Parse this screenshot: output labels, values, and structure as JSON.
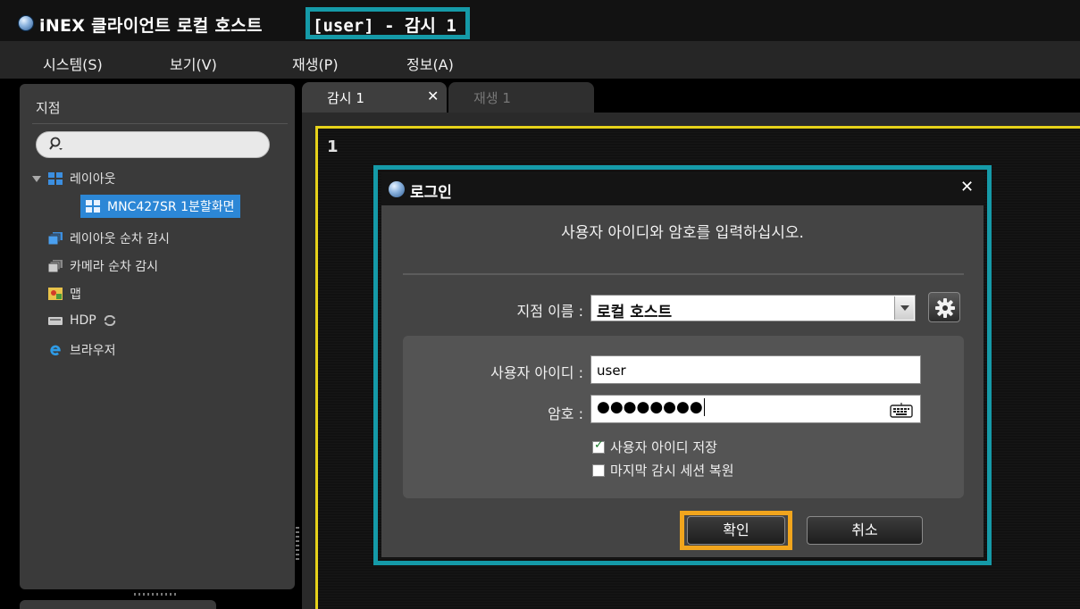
{
  "titlebar": {
    "title": "iNEX 클라이언트 로컬 호스트",
    "active_title": "[user] - 감시 1"
  },
  "menu": {
    "items": [
      "시스템(S)",
      "보기(V)",
      "재생(P)",
      "정보(A)"
    ]
  },
  "sidebar": {
    "title": "지점",
    "search_placeholder": "",
    "tree": {
      "layout": "레이아웃",
      "layout_child": "MNC427SR 1분할화면",
      "layout_sequence": "레이아웃 순차 감시",
      "camera_sequence": "카메라 순차 감시",
      "map": "맵",
      "hdp": "HDP",
      "browser": "브라우저"
    }
  },
  "tabs": [
    {
      "label": "감시 1",
      "active": true
    },
    {
      "label": "재생 1",
      "active": false
    }
  ],
  "view": {
    "number": "1"
  },
  "dialog": {
    "title": "로그인",
    "message": "사용자 아이디와 암호를 입력하십시오.",
    "site_label": "지점 이름 :",
    "site_value": "로컬 호스트",
    "user_label": "사용자 아이디 :",
    "user_value": "user",
    "password_label": "암호 :",
    "password_value": "●●●●●●●●",
    "save_id_label": "사용자 아이디 저장",
    "save_id_checked": true,
    "restore_label": "마지막 감시 세션 복원",
    "restore_checked": false,
    "ok_label": "확인",
    "cancel_label": "취소"
  },
  "colors": {
    "highlight_teal": "#159aa8",
    "highlight_orange": "#f1a51d",
    "view_border_yellow": "#e6d21a",
    "selection_blue": "#2c87d6"
  }
}
